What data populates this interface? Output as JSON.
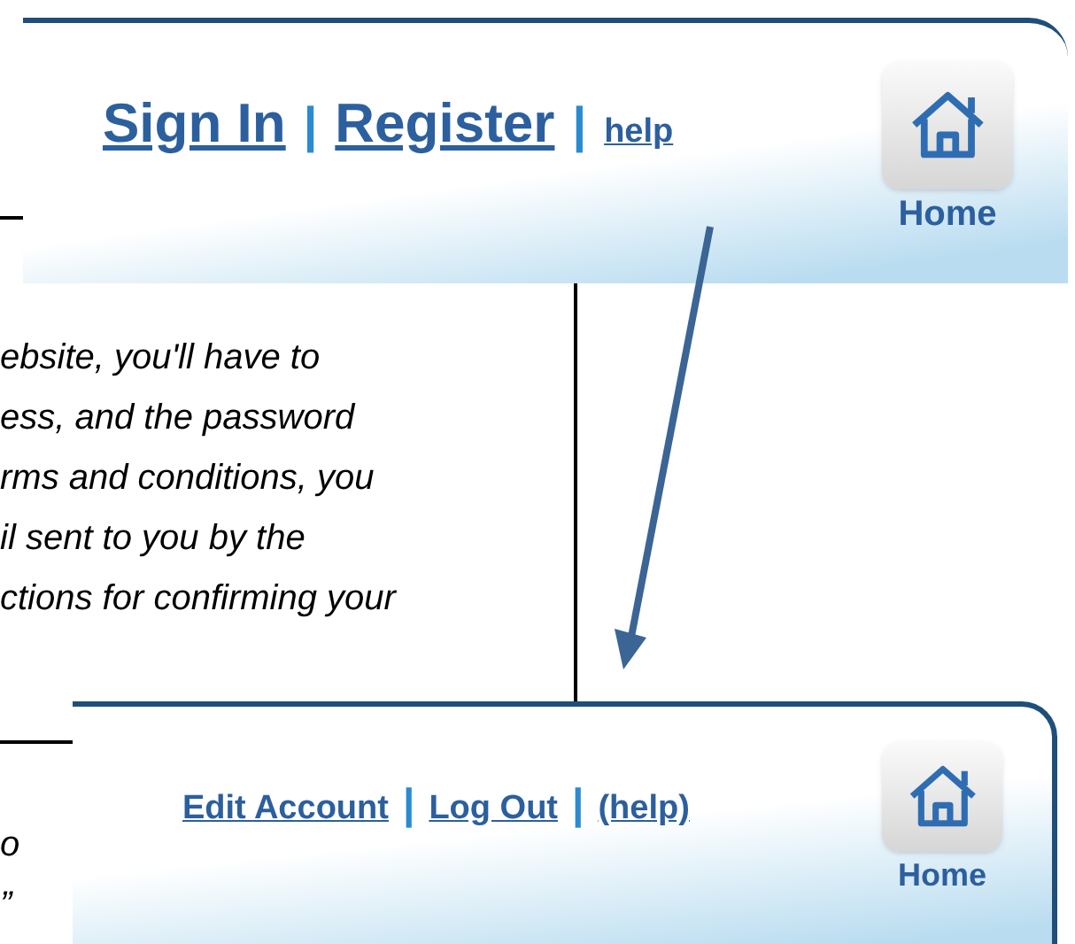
{
  "top_header": {
    "links": [
      {
        "text": "Sign In"
      },
      {
        "text": "Register"
      },
      {
        "text": "help"
      }
    ],
    "separators": [
      "|",
      "|"
    ],
    "home_label": "Home"
  },
  "document_text": {
    "lines": [
      "ebsite, you'll have to",
      "ess, and the password",
      "rms and conditions, you",
      "il sent to you by the",
      "ctions for confirming your"
    ]
  },
  "lower_text": {
    "lines": [
      "o",
      "”"
    ]
  },
  "bottom_header": {
    "links": [
      {
        "text": "Edit Account"
      },
      {
        "text": "Log Out"
      },
      {
        "text": "(help)"
      }
    ],
    "separators": [
      "|",
      "|"
    ],
    "home_label": "Home"
  }
}
